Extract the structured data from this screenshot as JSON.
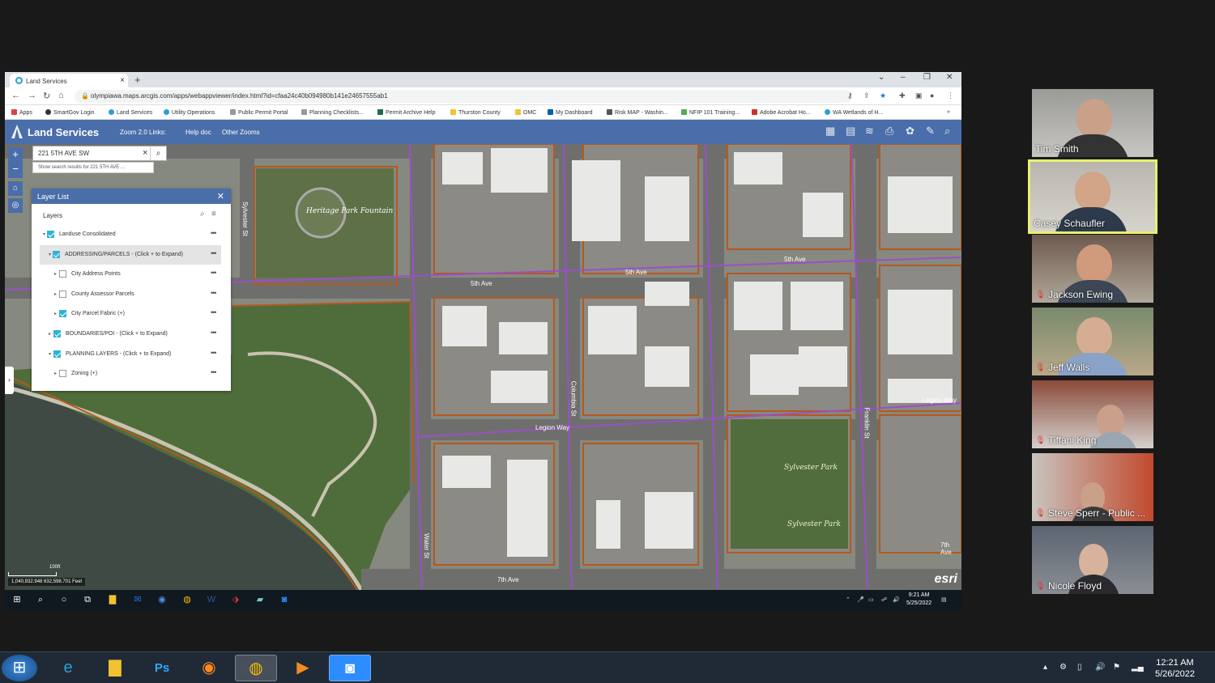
{
  "browser": {
    "tab_title": "Land Services",
    "url": "olympiawa.maps.arcgis.com/apps/webappviewer/index.html?id=cfaa24c40b094980b141e24657555ab1",
    "bookmarks": [
      "Apps",
      "SmartGov Login",
      "Land Services",
      "Utility Operations",
      "Public Permit Portal",
      "Planning Checklists...",
      "Permit Archive Help",
      "Thurston County",
      "OMC",
      "My Dashboard",
      "Risk MAP - Washin...",
      "NFIP 101 Training...",
      "Adobe Acrobat Ho...",
      "WA Wetlands of H..."
    ]
  },
  "app": {
    "title": "Land Services",
    "links": [
      "Zoom 2.0 Links:",
      "Help doc",
      "Other Zooms"
    ]
  },
  "search": {
    "value": "221 5TH AVE SW",
    "suggestion": "Show search results for 221 5TH AVE ..."
  },
  "layer_list": {
    "title": "Layer List",
    "subtitle": "Layers",
    "items": [
      {
        "label": "Landuse Consolidated",
        "checked": true
      },
      {
        "label": "ADDRESSING/PARCELS - (Click + to Expand)",
        "checked": true
      },
      {
        "label": "City Address Points",
        "checked": false
      },
      {
        "label": "County Assessor Parcels",
        "checked": false
      },
      {
        "label": "City Parcel Fabric (+)",
        "checked": true
      },
      {
        "label": "BOUNDARIES/POI - (Click + to Expand)",
        "checked": true
      },
      {
        "label": "PLANNING LAYERS - (Click + to Expand)",
        "checked": true
      },
      {
        "label": "Zoning (+)",
        "checked": false
      }
    ]
  },
  "map": {
    "coords": "1,040,932.948 632,598.701 Feet",
    "scale": "100ft",
    "esri": "esri",
    "streets": [
      "5th Ave",
      "5th Ave",
      "5th Ave",
      "Legion Way",
      "Legion Way",
      "7th Ave",
      "7th Ave",
      "Columbia St",
      "Water St",
      "Sylvester St",
      "Franklin St"
    ],
    "places": [
      "Heritage Park Fountain",
      "Sylvester Park",
      "Sylvester Park"
    ]
  },
  "screen_taskbar": {
    "time": "9:21 AM",
    "date": "5/25/2022"
  },
  "participants": [
    {
      "name": "Tim Smith",
      "muted": false,
      "active": false
    },
    {
      "name": "Casey Schaufler",
      "muted": false,
      "active": true
    },
    {
      "name": "Jackson Ewing",
      "muted": true,
      "active": false
    },
    {
      "name": "Jeff Walls",
      "muted": true,
      "active": false
    },
    {
      "name": "Tiffani King",
      "muted": true,
      "active": false
    },
    {
      "name": "Steve Sperr - Public ...",
      "muted": true,
      "active": false
    },
    {
      "name": "Nicole Floyd",
      "muted": true,
      "active": false
    }
  ],
  "taskbar": {
    "time": "12:21 AM",
    "date": "5/26/2022"
  },
  "colors": {
    "header": "#4a6ea9",
    "parcel": "#b5581f",
    "road_line": "#9b4fc8"
  }
}
